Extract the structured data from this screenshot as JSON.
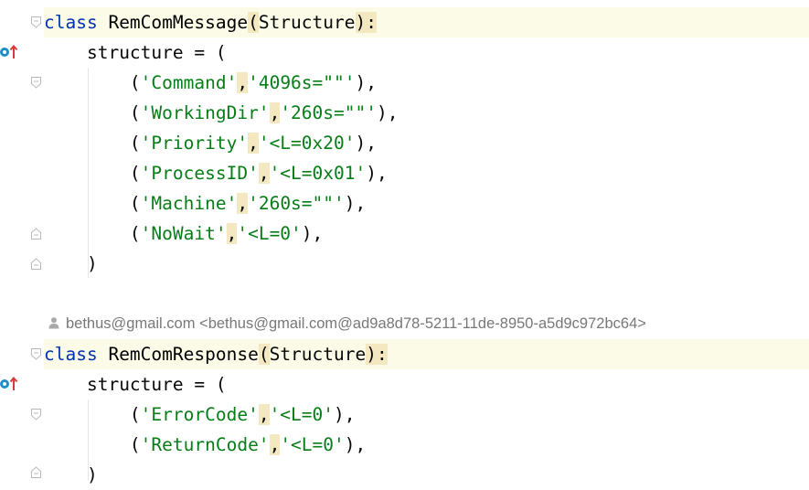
{
  "classes": [
    {
      "keyword": "class",
      "name": "RemComMessage",
      "base_open": "(",
      "base": "Structure",
      "base_close": "):",
      "field_decl": "structure = (",
      "entries": [
        {
          "name": "'Command'",
          "fmt": "'4096s=\"\"'"
        },
        {
          "name": "'WorkingDir'",
          "fmt": "'260s=\"\"'"
        },
        {
          "name": "'Priority'",
          "fmt": "'<L=0x20'"
        },
        {
          "name": "'ProcessID'",
          "fmt": "'<L=0x01'"
        },
        {
          "name": "'Machine'",
          "fmt": "'260s=\"\"'"
        },
        {
          "name": "'NoWait'",
          "fmt": "'<L=0'"
        }
      ],
      "close": ")"
    },
    {
      "keyword": "class",
      "name": "RemComResponse",
      "base_open": "(",
      "base": "Structure",
      "base_close": "):",
      "field_decl": "structure = (",
      "entries": [
        {
          "name": "'ErrorCode'",
          "fmt": "'<L=0'"
        },
        {
          "name": "'ReturnCode'",
          "fmt": "'<L=0'"
        }
      ],
      "close": ")"
    }
  ],
  "blame": {
    "author": "bethus@gmail.com <bethus@gmail.com@ad9a8d78-5211-11de-8950-a5d9c972bc64>",
    "icon": "person-icon"
  },
  "punct": {
    "open_paren": "(",
    "comma": ",",
    "entry_close": "),"
  },
  "colors": {
    "keyword": "#0033b3",
    "string": "#067d17",
    "highlight_line": "#fcfbe8",
    "match_mark": "#f3e8c0",
    "blame_text": "#787878",
    "impl_marker": "#1e8ec9"
  }
}
